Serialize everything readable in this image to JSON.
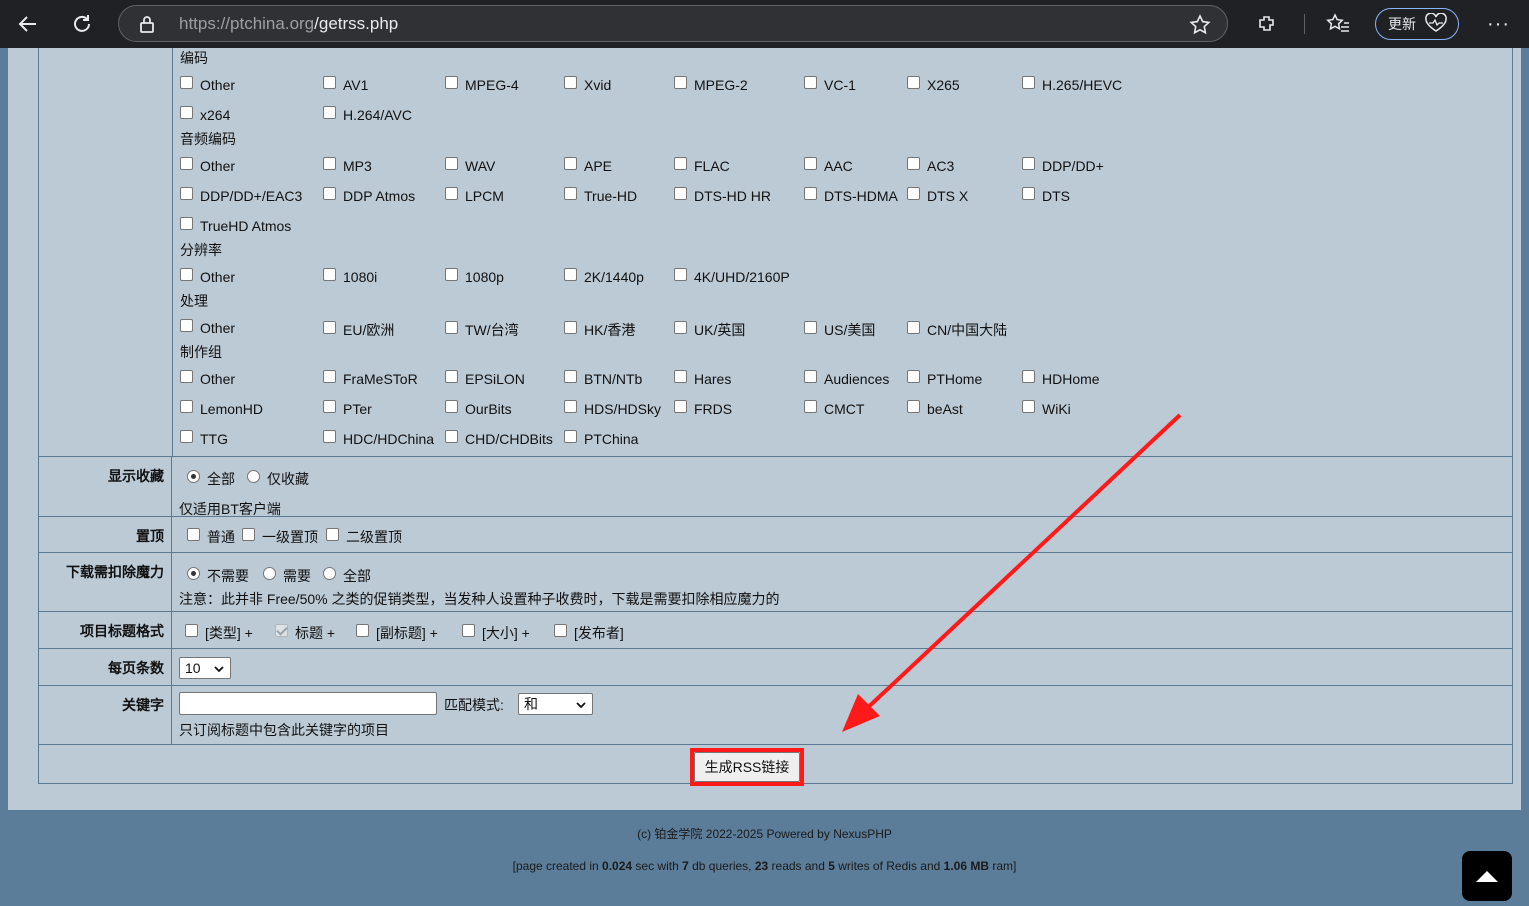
{
  "browser": {
    "url_host": "https://ptchina.org",
    "url_path": "/getrss.php",
    "update_label": "更新"
  },
  "filters": {
    "video_codec": {
      "title": "编码",
      "options": [
        "Other",
        "AV1",
        "MPEG-4",
        "Xvid",
        "MPEG-2",
        "VC-1",
        "X265",
        "H.265/HEVC",
        "x264",
        "H.264/AVC"
      ]
    },
    "audio_codec": {
      "title": "音频编码",
      "options": [
        "Other",
        "MP3",
        "WAV",
        "APE",
        "FLAC",
        "AAC",
        "AC3",
        "DDP/DD+",
        "DDP/DD+/EAC3",
        "DDP Atmos",
        "LPCM",
        "True-HD",
        "DTS-HD HR",
        "DTS-HDMA",
        "DTS X",
        "DTS",
        "TrueHD Atmos"
      ]
    },
    "resolution": {
      "title": "分辨率",
      "options": [
        "Other",
        "1080i",
        "1080p",
        "2K/1440p",
        "4K/UHD/2160P"
      ]
    },
    "processing": {
      "title": "处理",
      "options": [
        "Other",
        "EU/欧洲",
        "TW/台湾",
        "HK/香港",
        "UK/英国",
        "US/美国",
        "CN/中国大陆"
      ]
    },
    "team": {
      "title": "制作组",
      "options": [
        "Other",
        "FraMeSToR",
        "EPSiLON",
        "BTN/NTb",
        "Hares",
        "Audiences",
        "PTHome",
        "HDHome",
        "LemonHD",
        "PTer",
        "OurBits",
        "HDS/HDSky",
        "FRDS",
        "CMCT",
        "beAst",
        "WiKi",
        "TTG",
        "HDC/HDChina",
        "CHD/CHDBits",
        "PTChina"
      ]
    }
  },
  "show_bookmarked": {
    "label": "显示收藏",
    "options": [
      "全部",
      "仅收藏"
    ],
    "selected": "全部",
    "note": "仅适用BT客户端"
  },
  "sticky": {
    "label": "置顶",
    "options": [
      "普通",
      "一级置顶",
      "二级置顶"
    ]
  },
  "magic_deduct": {
    "label": "下载需扣除魔力",
    "options": [
      "不需要",
      "需要",
      "全部"
    ],
    "selected": "不需要",
    "note": "注意：此并非 Free/50% 之类的促销类型，当发种人设置种子收费时，下载是需要扣除相应魔力的"
  },
  "title_format": {
    "label": "项目标题格式",
    "parts": [
      "[类型] +",
      "标题 +",
      "[副标题] +",
      "[大小] +",
      "[发布者]"
    ]
  },
  "per_page": {
    "label": "每页条数",
    "value": "10"
  },
  "keyword": {
    "label": "关键字",
    "value": "",
    "match_label": "匹配模式:",
    "match_value": "和",
    "note": "只订阅标题中包含此关键字的项目"
  },
  "generate_button": "生成RSS链接",
  "footer": {
    "copyright": "(c) 铂金学院 2022-2025 Powered by NexusPHP",
    "stats_prefix": "[page created in ",
    "time": "0.024",
    "stats_mid1": " sec with ",
    "queries": "7",
    "stats_mid2": " db queries, ",
    "reads": "23",
    "stats_mid3": " reads and ",
    "writes": "5",
    "stats_mid4": " writes of Redis and ",
    "ram": "1.06 MB",
    "stats_suffix": " ram]"
  },
  "colors": {
    "page_bg": "#bccad6",
    "outer_bg": "#5b7d99",
    "highlight": "#ff1a1a"
  }
}
